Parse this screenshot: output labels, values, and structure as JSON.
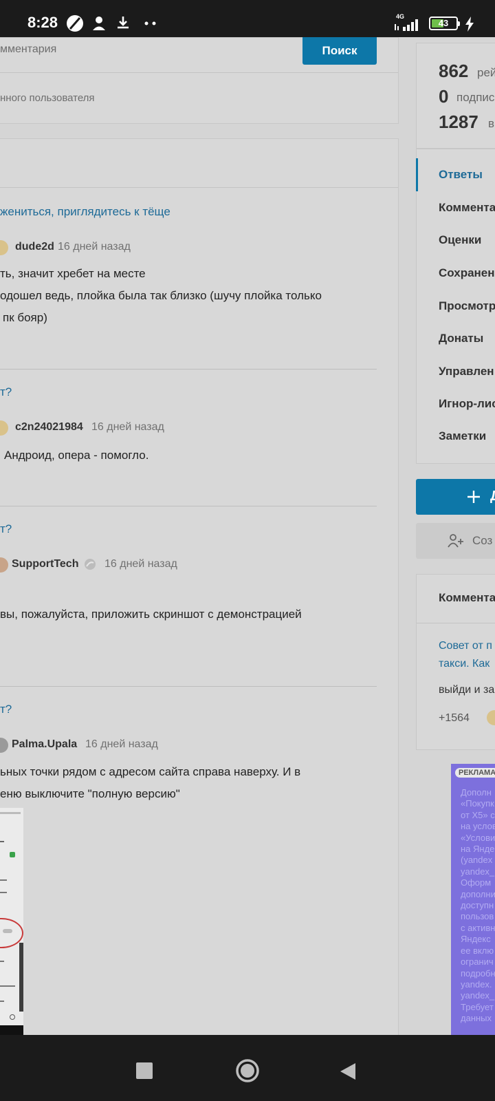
{
  "status_bar": {
    "time": "8:28",
    "network": "4G",
    "battery": "43"
  },
  "search": {
    "placeholder_tail": "мментария",
    "button": "Поиск",
    "option": "нного пользователя"
  },
  "comments": [
    {
      "title": "жениться, приглядитесь к тёще",
      "author": "dude2d",
      "time": "16 дней назад",
      "body": [
        "ть, значит хребет на месте",
        "одошел ведь, плойка была так близко (шучу плойка только",
        "пк бояр)"
      ]
    },
    {
      "title": "т?",
      "author": "c2n24021984",
      "time": "16 дней назад",
      "body": [
        "Андроид, опера - помогло."
      ]
    },
    {
      "title": "т?",
      "author": "SupportTech",
      "time": "16 дней назад",
      "body": [
        "вы, пожалуйста, приложить скриншот с демонстрацией"
      ]
    },
    {
      "title": "т?",
      "author": "Palma.Upala",
      "time": "16 дней назад",
      "body": [
        "ьных точки рядом с адресом сайта справа наверху. И в",
        "еню выключите \"полную версию\""
      ]
    }
  ],
  "sidebar": {
    "stats": [
      {
        "num": "862",
        "label": "рей"
      },
      {
        "num": "0",
        "label": "подпис"
      },
      {
        "num": "1287",
        "label": "в"
      }
    ],
    "menu": [
      "Ответы",
      "Коммента",
      "Оценки",
      "Сохранен",
      "Просмотр",
      "Донаты",
      "Управлен",
      "Игнор-лис",
      "Заметки"
    ],
    "add_button": "Д",
    "create_button": "Соз",
    "comments_header": "Коммента",
    "featured": {
      "title": [
        "Совет от п",
        "такси. Как"
      ],
      "body": "выйди и за",
      "rating": "+1564"
    },
    "ad": {
      "badge": "РЕКЛАМА",
      "lines": [
        "Дополн",
        "«Покупк",
        "от X5» с",
        "на услов",
        "«Услови",
        "на Янде",
        "(yandex",
        "yandex_",
        "Оформ",
        "дополни",
        "доступн",
        "пользов",
        "с активн",
        "Яндекс",
        "ее вклю",
        "огранич",
        "подробн",
        "yandex.",
        "yandex_",
        "Требует",
        "данных"
      ]
    }
  }
}
